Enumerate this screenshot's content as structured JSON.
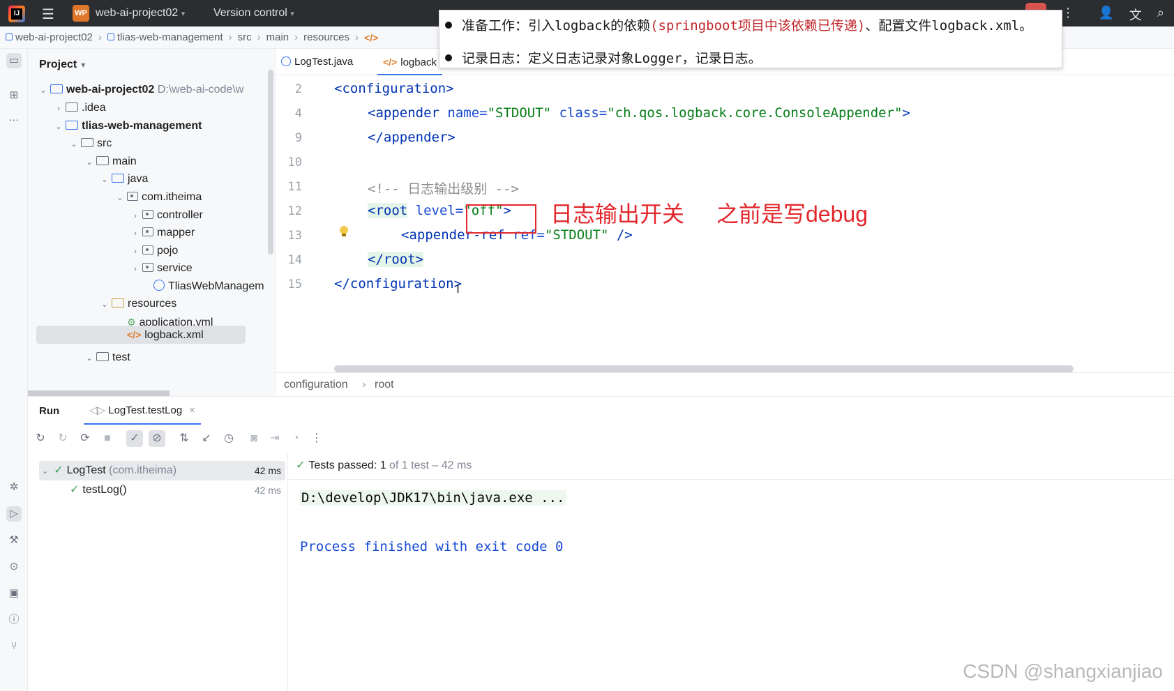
{
  "titlebar": {
    "project_badge": "WP",
    "project_name": "web-ai-project02",
    "version_control": "Version control"
  },
  "breadcrumb": [
    "web-ai-project02",
    "tlias-web-management",
    "src",
    "main",
    "resources"
  ],
  "project_panel": {
    "title": "Project",
    "root_name": "web-ai-project02",
    "root_path": "D:\\web-ai-code\\w",
    "items": {
      "idea": ".idea",
      "module": "tlias-web-management",
      "src": "src",
      "main": "main",
      "java": "java",
      "pkg": "com.itheima",
      "controller": "controller",
      "mapper": "mapper",
      "pojo": "pojo",
      "service": "service",
      "app_class": "TliasWebManagem",
      "resources": "resources",
      "app_yml": "application.yml",
      "logback": "logback.xml",
      "test": "test"
    }
  },
  "editor": {
    "tabs": [
      "LogTest.java",
      "logback"
    ],
    "line_numbers": [
      "2",
      "4",
      "9",
      "10",
      "11",
      "12",
      "13",
      "14",
      "15"
    ],
    "code": {
      "l2": "<configuration>",
      "l4_tag": "<appender",
      "l4_name_attr": "name=",
      "l4_name_val": "\"STDOUT\"",
      "l4_class_attr": "class=",
      "l4_class_val": "\"ch.qos.logback.core.ConsoleAppender\"",
      "l4_end": ">",
      "l9": "</appender>",
      "l11": "<!-- 日志输出级别 -->",
      "l12_tag": "<root",
      "l12_attr": "level=",
      "l12_val": "\"off\"",
      "l12_end": ">",
      "l13_tag": "<appender-ref",
      "l13_attr": "ref=",
      "l13_val": "\"STDOUT\"",
      "l13_end": " />",
      "l14": "</root>",
      "l15": "</configuration>"
    },
    "annotations": {
      "switch": "日志输出开关",
      "before": "之前是写debug"
    },
    "bottom_crumbs": [
      "configuration",
      "root"
    ]
  },
  "tooltip": {
    "line1_a": "准备工作：引入logback的依赖",
    "line1_red": "(springboot项目中该依赖已传递)",
    "line1_b": "、配置文件logback.xml。",
    "line2": "记录日志：定义日志记录对象Logger，记录日志。"
  },
  "run_panel": {
    "title": "Run",
    "tab": "LogTest.testLog",
    "tree": {
      "suite_name": "LogTest",
      "suite_pkg": "(com.itheima)",
      "suite_time": "42 ms",
      "test_name": "testLog()",
      "test_time": "42 ms"
    },
    "status": {
      "label": "Tests passed:",
      "count": "1",
      "rest": "of 1 test – 42 ms"
    },
    "console": {
      "cmd": "D:\\develop\\JDK17\\bin\\java.exe ...",
      "exit": "Process finished with exit code 0"
    }
  },
  "watermark": "CSDN @shangxianjiao"
}
